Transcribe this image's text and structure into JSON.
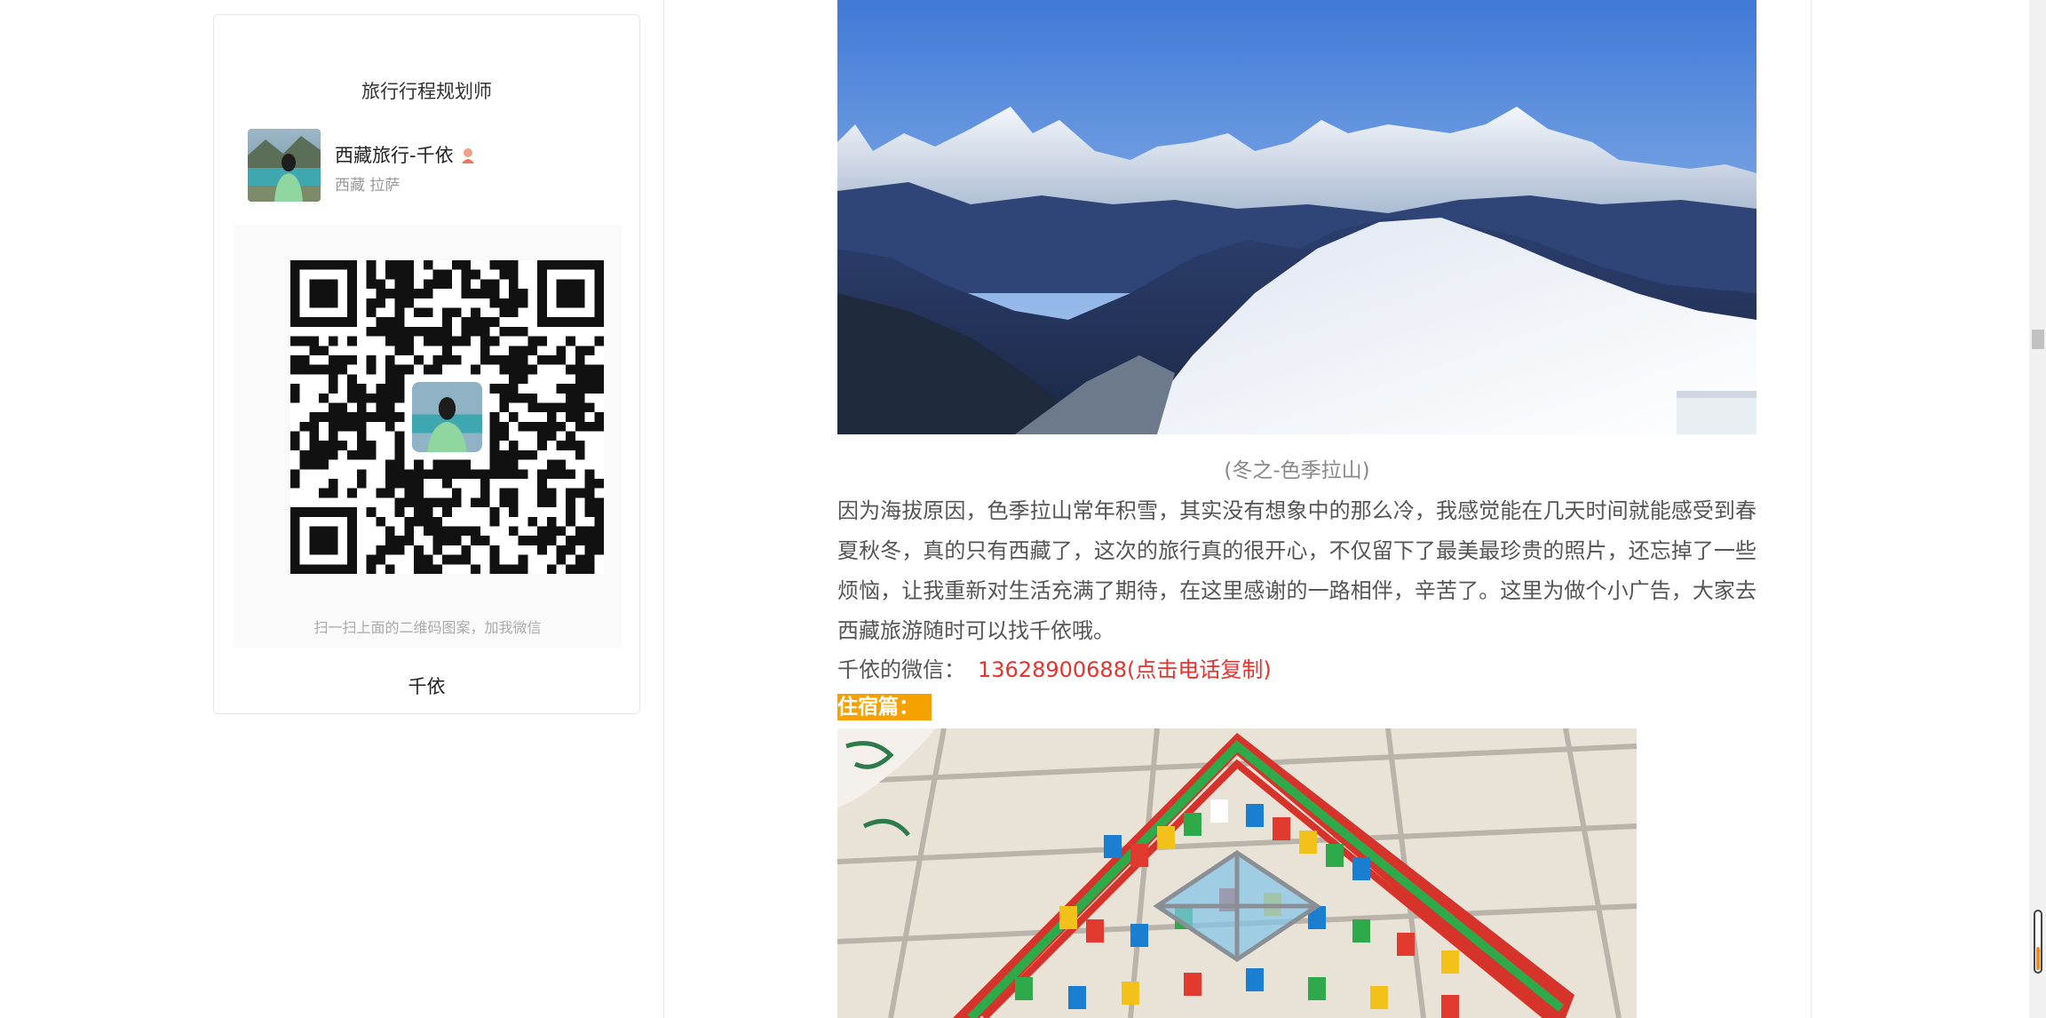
{
  "sidebar_card": {
    "title": "旅行行程规划师",
    "profile": {
      "name": "西藏旅行-千依",
      "location": "西藏 拉萨"
    },
    "qr_hint": "扫一扫上面的二维码图案，加我微信",
    "footer_name": "千依"
  },
  "article": {
    "photo1_caption": "(冬之-色季拉山)",
    "paragraph": "因为海拔原因，色季拉山常年积雪，其实没有想象中的那么冷，我感觉能在几天时间就能感受到春夏秋冬，真的只有西藏了，这次的旅行真的很开心，不仅留下了最美最珍贵的照片，还忘掉了一些烦恼，让我重新对生活充满了期待，在这里感谢的一路相伴，辛苦了。这里为做个小广告，大家去西藏旅游随时可以找千依哦。",
    "wechat_label": "千依的微信：",
    "wechat_phone": "13628900688(点击电话复制)",
    "section_label": "住宿篇："
  },
  "colors": {
    "accent_orange": "#f5a100",
    "phone_red": "#e3342f"
  },
  "icons": {
    "name_badge": "person-badge-icon"
  }
}
